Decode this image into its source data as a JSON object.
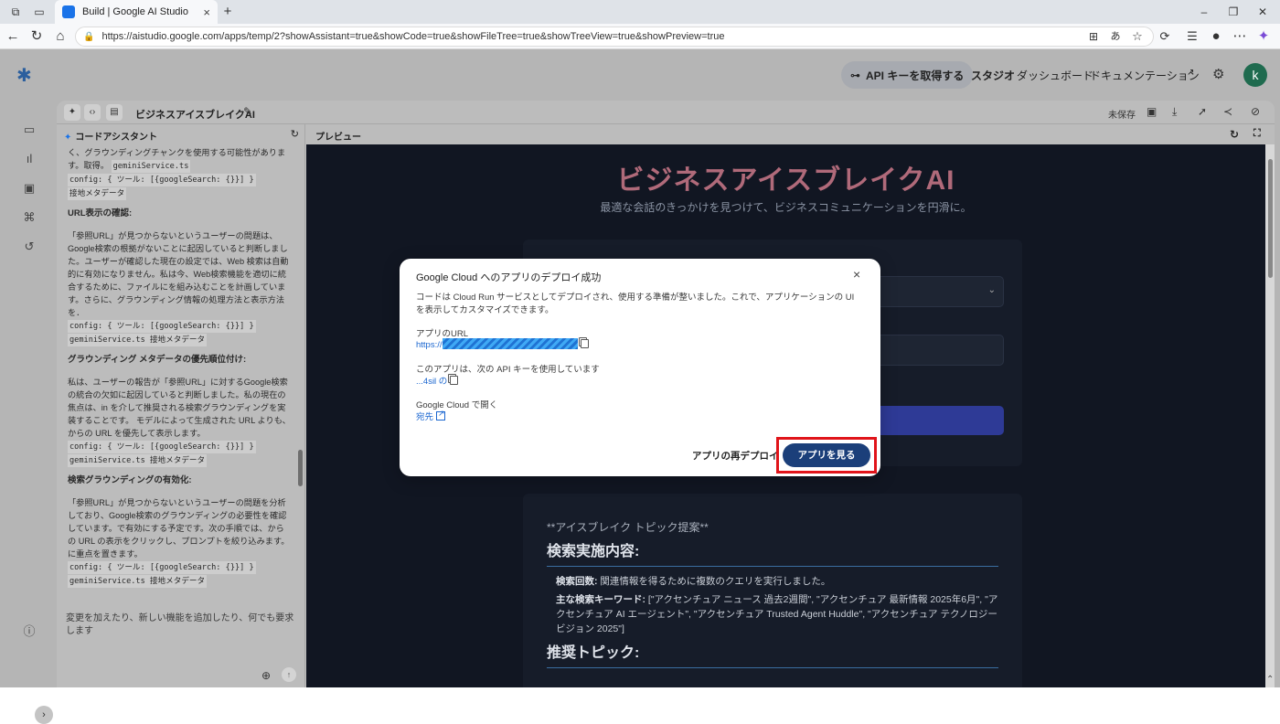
{
  "browser": {
    "tab_title": "Build | Google AI Studio",
    "tab_close": "×",
    "new_tab": "+",
    "url": "https://aistudio.google.com/apps/temp/2?showAssistant=true&showCode=true&showFileTree=true&showTreeView=true&showPreview=true"
  },
  "topbar": {
    "api_key_label": "API キーを取得する",
    "nav_studio": "スタジオ",
    "nav_dashboard": "ダッシュボード",
    "nav_docs": "ドキュメンテーション",
    "avatar_letter": "k"
  },
  "workspace": {
    "project_title": "ビジネスアイスブレイクAI",
    "unsaved": "未保存"
  },
  "assistant": {
    "header": "コードアシスタント",
    "p1": "く、グラウンディングチャンクを使用する可能性があります。取得。",
    "p1_code1": "geminiService.ts",
    "p1_code2": "config: { ツール: [{googleSearch: {}}] }",
    "p1_code3": "接地メタデータ",
    "h1": "URL表示の確認:",
    "p2": "「参照URL」が見つからないというユーザーの問題は、Google検索の根拠がないことに起因していると判断しました。ユーザーが確認した現在の設定では、Web 検索は自動的に有効になりません。私は今、Web検索機能を適切に統合するために、ファイルにを組み込むことを計画しています。さらに、グラウンディング情報の処理方法と表示方法を．",
    "p2_code1": "config: { ツール: [{googleSearch: {}}] }",
    "p2_code2": "geminiService.ts 接地メタデータ",
    "h2": "グラウンディング メタデータの優先順位付け:",
    "p3": "私は、ユーザーの報告が「参照URL」に対するGoogle検索の統合の欠如に起因していると判断しました。私の現在の焦点は、in を介して推奨される検索グラウンディングを実装することです。 モデルによって生成された URL よりも、からの URL を優先して表示します。",
    "p3_code1": "config: { ツール: [{googleSearch: {}}] }",
    "p3_code2": "geminiService.ts 接地メタデータ",
    "h3": "検索グラウンディングの有効化:",
    "p4": "「参照URL」が見つからないというユーザーの問題を分析しており、Google検索のグラウンディングの必要性を確認しています。で有効にする予定です。次の手順では、からの URL の表示をクリックし、プロンプトを絞り込みます。に重点を置きます。",
    "p4_code1": "config: { ツール: [{googleSearch: {}}] }",
    "p4_code2": "geminiService.ts 接地メタデータ",
    "input_placeholder": "変更を加えたり、新しい機能を追加したり、何でも要求します"
  },
  "preview": {
    "header": "プレビュー",
    "hero_title": "ビジネスアイスブレイクAI",
    "hero_sub": "最適な会話のきっかけを見つけて、ビジネスコミュニケーションを円滑に。",
    "card2_star": "**アイスブレイク トピック提案**",
    "card2_h1": "検索実施内容:",
    "card2_item1_label": "検索回数:",
    "card2_item1_text": " 関連情報を得るために複数のクエリを実行しました。",
    "card2_item2_label": "主な検索キーワード:",
    "card2_item2_text": " [\"アクセンチュア ニュース 過去2週間\", \"アクセンチュア 最新情報 2025年6月\", \"アクセンチュア AI エージェント\", \"アクセンチュア Trusted Agent Huddle\", \"アクセンチュア テクノロジービジョン 2025\"]",
    "card2_h2": "推奨トピック:"
  },
  "modal": {
    "title": "Google Cloud へのアプリのデプロイ成功",
    "close": "×",
    "desc": "コードは Cloud Run サービスとしてデプロイされ、使用する準備が整いました。これで、アプリケーションの UI を表示してカスタマイズできます。",
    "url_label": "アプリのURL",
    "url_prefix": "https://",
    "api_label": "このアプリは、次の API キーを使用しています",
    "api_value": "...4sil の",
    "cloud_label": "Google Cloud で開く",
    "cloud_link": "宛先",
    "redeploy": "アプリの再デプロイ",
    "view_app": "アプリを見る"
  }
}
